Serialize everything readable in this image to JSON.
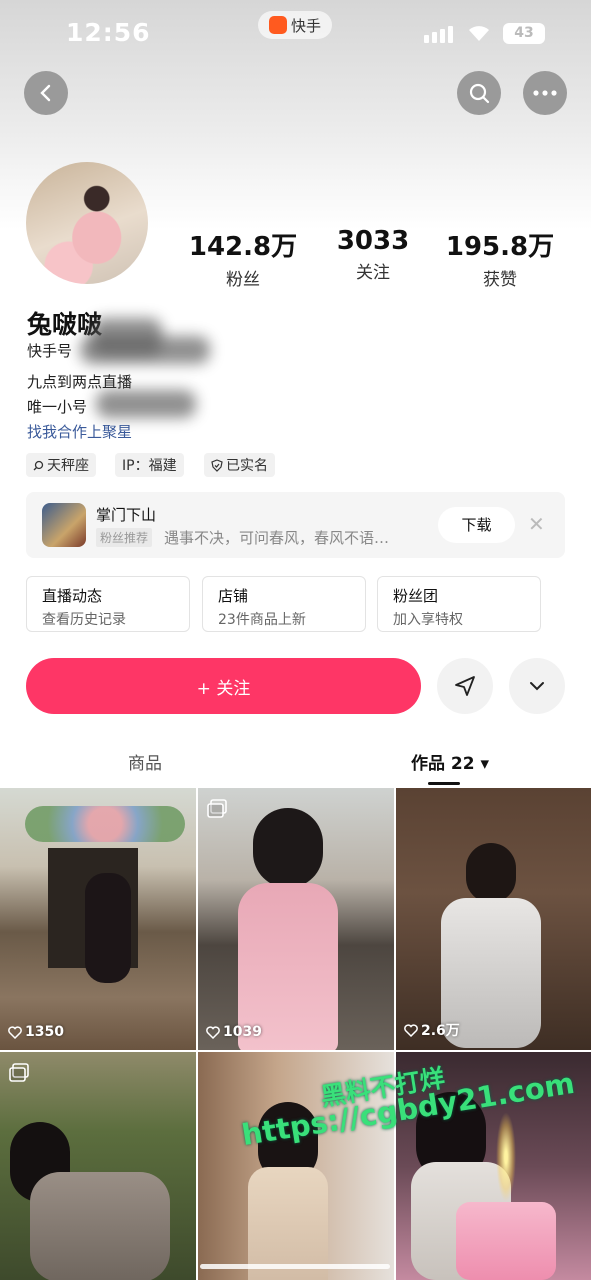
{
  "status_bar": {
    "time": "12:56",
    "app_name": "快手",
    "battery": "43"
  },
  "profile": {
    "stats": [
      {
        "value": "142.8万",
        "label": "粉丝"
      },
      {
        "value": "3033",
        "label": "关注"
      },
      {
        "value": "195.8万",
        "label": "获赞"
      }
    ],
    "name": "兔啵啵",
    "kuaishou_id_label": "快手号",
    "bio_line1": "九点到两点直播",
    "bio_line2": "唯一小号",
    "bio_link": "找我合作上聚星",
    "tags": [
      "天秤座",
      "IP：福建",
      "已实名"
    ]
  },
  "game_card": {
    "title": "掌门下山",
    "tag": "粉丝推荐",
    "description": "遇事不决，可问春风，春风不语…",
    "download_label": "下载",
    "close_glyph": "✕"
  },
  "shortcuts": [
    {
      "title": "直播动态",
      "subtitle": "查看历史记录"
    },
    {
      "title": "店铺",
      "subtitle": "23件商品上新"
    },
    {
      "title": "粉丝团",
      "subtitle": "加入享特权"
    }
  ],
  "actions": {
    "follow_label": "+ 关注"
  },
  "tabs": {
    "goods": "商品",
    "works": "作品 22 ▾"
  },
  "works": [
    {
      "likes": "1350",
      "multi": false
    },
    {
      "likes": "1039",
      "multi": true
    },
    {
      "likes": "2.6万",
      "multi": false
    },
    {
      "likes": "",
      "multi": true
    },
    {
      "likes": "",
      "multi": false
    },
    {
      "likes": "",
      "multi": false
    }
  ],
  "watermark": {
    "line1": "黑料不打烊",
    "line2": "https://cgbdy21.com"
  },
  "colors": {
    "follow": "#fe3666",
    "link": "#3a5a9a",
    "watermark": "#39e07a"
  }
}
